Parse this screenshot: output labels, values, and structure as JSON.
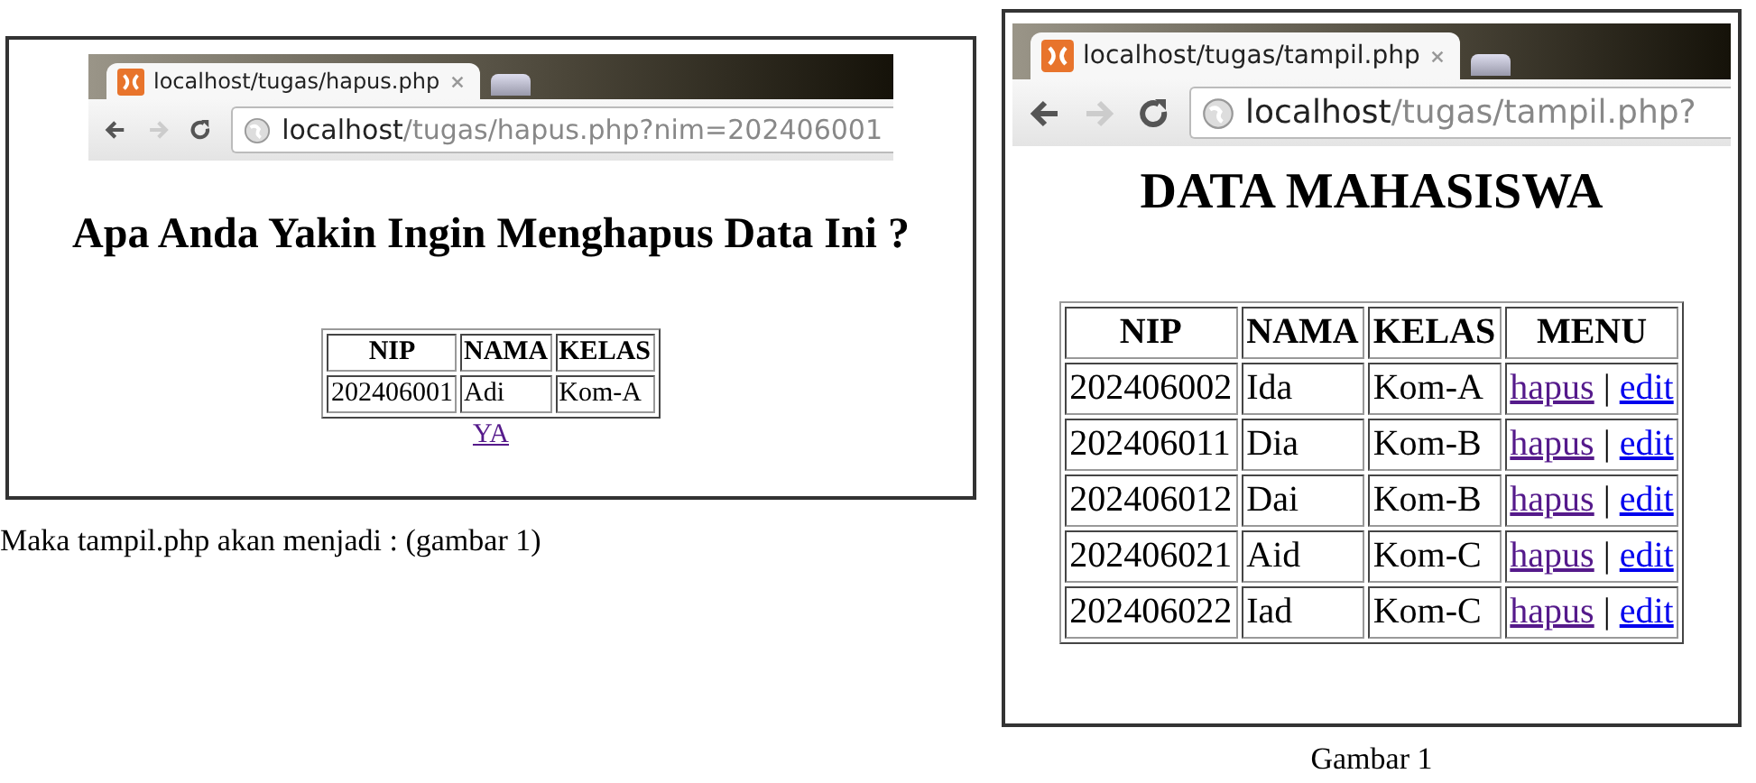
{
  "figures": [
    {
      "browser": {
        "tab_title": "localhost/tugas/hapus.php",
        "url_host": "localhost",
        "url_path": "/tugas/hapus.php?nim=202406001"
      },
      "heading": "Apa Anda Yakin Ingin Menghapus Data Ini ?",
      "table": {
        "columns": [
          "NIP",
          "NAMA",
          "KELAS"
        ],
        "rows": [
          {
            "cells": [
              "202406001",
              "Adi",
              "Kom-A"
            ]
          }
        ]
      },
      "confirm_link": {
        "label": "YA",
        "visited": true
      }
    },
    {
      "browser": {
        "tab_title": "localhost/tugas/tampil.php",
        "url_host": "localhost",
        "url_path": "/tugas/tampil.php?"
      },
      "heading": "DATA MAHASISWA",
      "table": {
        "columns": [
          "NIP",
          "NAMA",
          "KELAS",
          "MENU"
        ],
        "rows": [
          {
            "cells": [
              "202406002",
              "Ida",
              "Kom-A"
            ],
            "links": [
              {
                "label": "hapus",
                "visited": true
              },
              {
                "label": "edit",
                "visited": false
              }
            ],
            "separator": "|"
          },
          {
            "cells": [
              "202406011",
              "Dia",
              "Kom-B"
            ],
            "links": [
              {
                "label": "hapus",
                "visited": true
              },
              {
                "label": "edit",
                "visited": false
              }
            ],
            "separator": "|"
          },
          {
            "cells": [
              "202406012",
              "Dai",
              "Kom-B"
            ],
            "links": [
              {
                "label": "hapus",
                "visited": true
              },
              {
                "label": "edit",
                "visited": false
              }
            ],
            "separator": "|"
          },
          {
            "cells": [
              "202406021",
              "Aid",
              "Kom-C"
            ],
            "links": [
              {
                "label": "hapus",
                "visited": true
              },
              {
                "label": "edit",
                "visited": false
              }
            ],
            "separator": "|"
          },
          {
            "cells": [
              "202406022",
              "Iad",
              "Kom-C"
            ],
            "links": [
              {
                "label": "hapus",
                "visited": true
              },
              {
                "label": "edit",
                "visited": false
              }
            ],
            "separator": "|"
          }
        ]
      }
    }
  ],
  "left_caption": "Maka tampil.php akan menjadi : (gambar 1)",
  "right_caption": "Gambar 1"
}
